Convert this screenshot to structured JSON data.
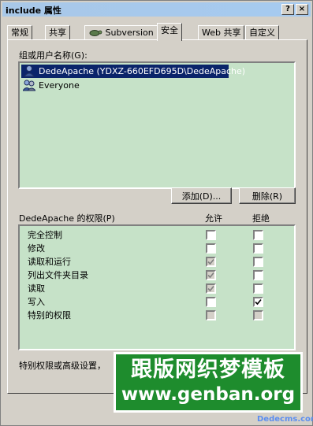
{
  "window": {
    "title": "include 属性",
    "help_button": "?",
    "close_button": "×"
  },
  "tabs": [
    {
      "label": "常规"
    },
    {
      "label": "共享"
    },
    {
      "label": "Subversion",
      "icon": "tortoise-icon"
    },
    {
      "label": "安全"
    },
    {
      "label": "Web 共享"
    },
    {
      "label": "自定义"
    }
  ],
  "security": {
    "users_label": "组或用户名称(G):",
    "users": [
      {
        "name": "DedeApache (YDXZ-660EFD695D\\DedeApache)",
        "icon": "user-icon",
        "selected": true
      },
      {
        "name": "Everyone",
        "icon": "group-icon",
        "selected": false
      }
    ],
    "add_button": "添加(D)...",
    "remove_button": "删除(R)",
    "perms_label": "DedeApache 的权限(P)",
    "allow_header": "允许",
    "deny_header": "拒绝",
    "permissions": [
      {
        "name": "完全控制",
        "allow": false,
        "allow_disabled": false,
        "deny": false,
        "deny_disabled": false
      },
      {
        "name": "修改",
        "allow": false,
        "allow_disabled": false,
        "deny": false,
        "deny_disabled": false
      },
      {
        "name": "读取和运行",
        "allow": true,
        "allow_disabled": true,
        "deny": false,
        "deny_disabled": false
      },
      {
        "name": "列出文件夹目录",
        "allow": true,
        "allow_disabled": true,
        "deny": false,
        "deny_disabled": false
      },
      {
        "name": "读取",
        "allow": true,
        "allow_disabled": true,
        "deny": false,
        "deny_disabled": false
      },
      {
        "name": "写入",
        "allow": false,
        "allow_disabled": false,
        "deny": true,
        "deny_disabled": false
      },
      {
        "name": "特别的权限",
        "allow": false,
        "allow_disabled": true,
        "deny": false,
        "deny_disabled": true
      }
    ],
    "advanced_text": "特别权限或高级设置，"
  },
  "watermark": {
    "line1": "跟版网织梦模板",
    "line2": "www.genban.org",
    "corner": "Dedecms.com"
  }
}
